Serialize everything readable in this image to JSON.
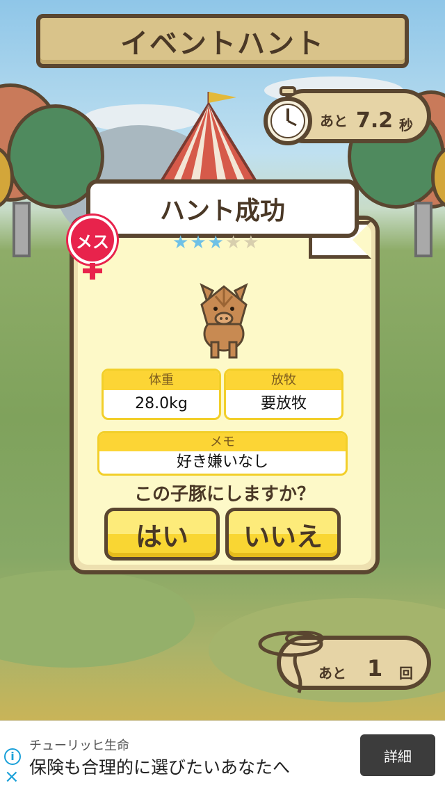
{
  "title": "イベントハント",
  "timer": {
    "label": "あと",
    "value": "7.2",
    "unit": "秒"
  },
  "result": {
    "heading": "ハント成功",
    "stars_filled": 3,
    "stars_total": 5,
    "gender_label": "メス",
    "weight": {
      "label": "体重",
      "value": "28.0kg"
    },
    "grazing": {
      "label": "放牧",
      "value": "要放牧"
    },
    "memo": {
      "label": "メモ",
      "value": "好き嫌いなし"
    },
    "question": "この子豚にしますか？",
    "yes_label": "はい",
    "no_label": "いいえ"
  },
  "remaining": {
    "label": "あと",
    "value": "1",
    "unit": "回"
  },
  "ad": {
    "sponsor": "チューリッヒ生命",
    "headline": "保険も合理的に選びたいあなたへ",
    "button_label": "詳細",
    "info_icon": "i",
    "close_icon": "×"
  },
  "colors": {
    "accent_yellow": "#f9d633",
    "brown": "#5a4630",
    "star_on": "#6fc1e6",
    "female_red": "#e8234c"
  }
}
